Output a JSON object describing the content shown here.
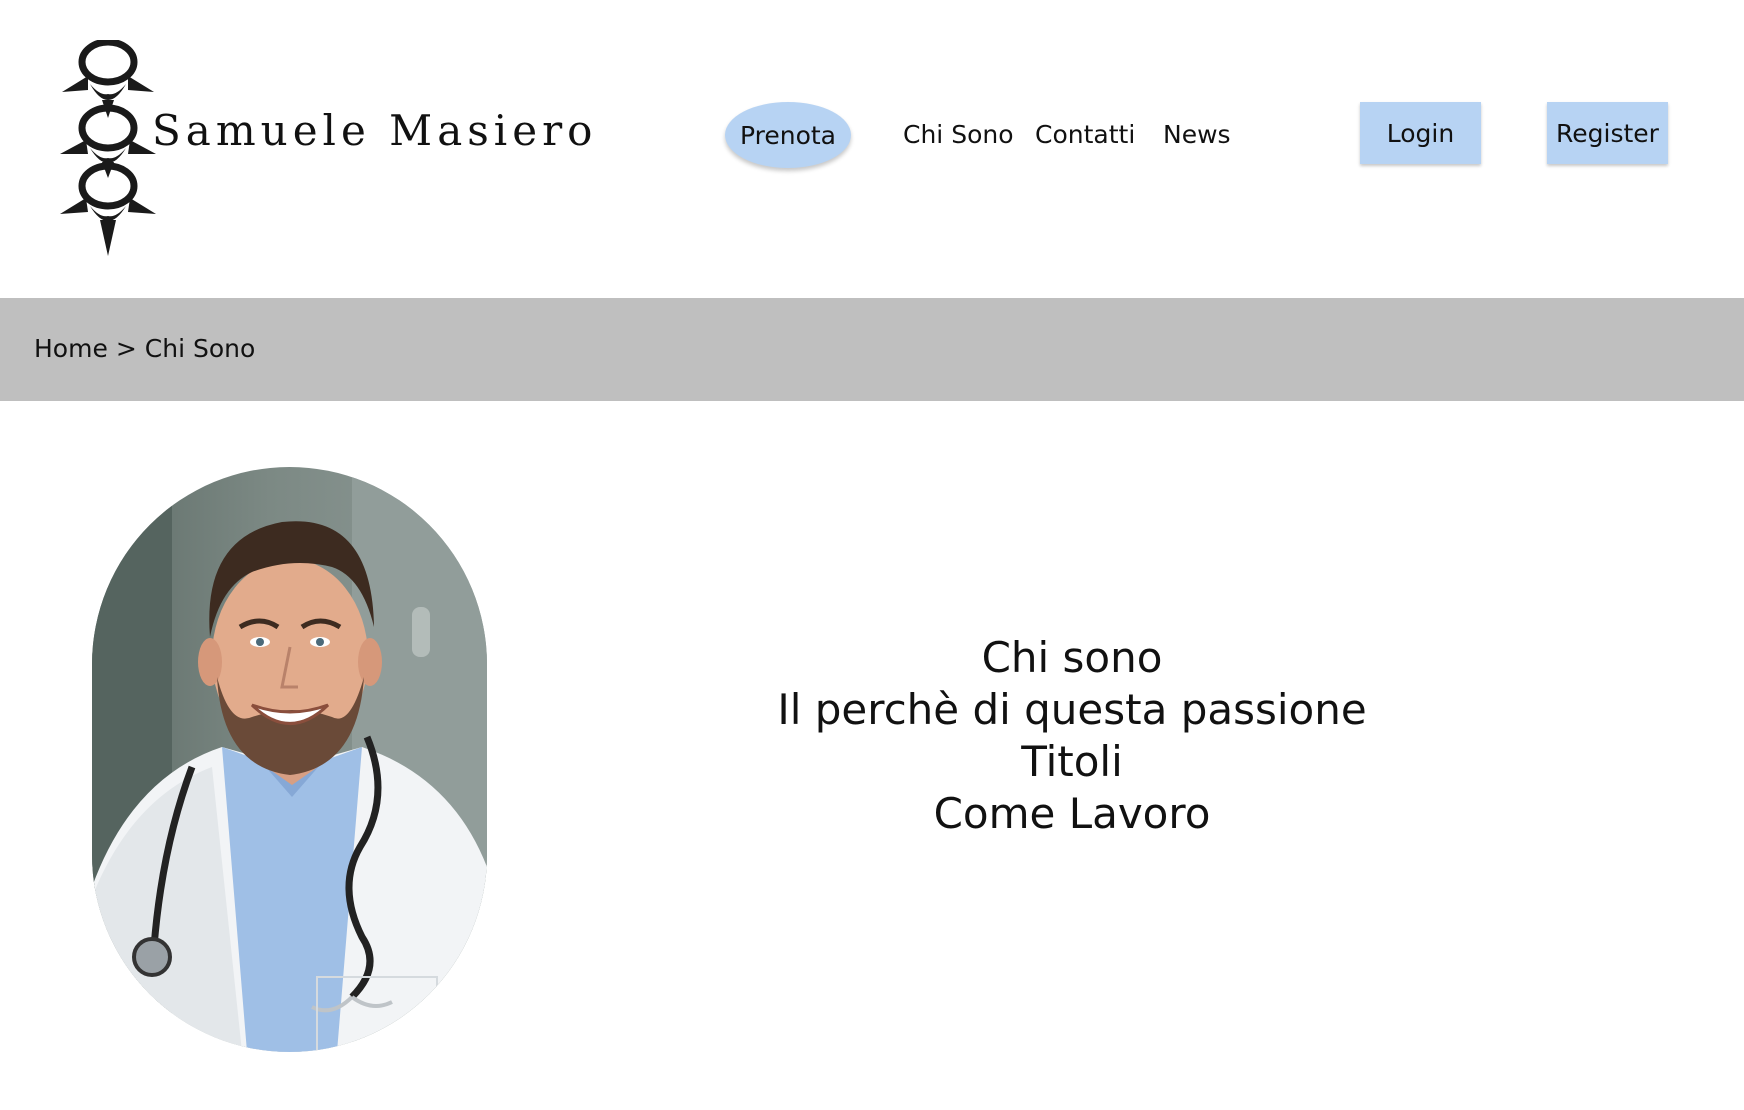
{
  "brand": {
    "name": "Samuele Masiero",
    "logo_icon": "spine-icon"
  },
  "nav": {
    "prenota_label": "Prenota",
    "items": [
      {
        "label": "Chi Sono"
      },
      {
        "label": "Contatti"
      },
      {
        "label": "News"
      }
    ],
    "login_label": "Login",
    "register_label": "Register"
  },
  "breadcrumb": {
    "home": "Home",
    "separator": ">",
    "current": "Chi Sono"
  },
  "main": {
    "photo_subject": "doctor-portrait",
    "links": [
      {
        "label": "Chi sono"
      },
      {
        "label": "Il perchè di questa passione"
      },
      {
        "label": "Titoli"
      },
      {
        "label": "Come Lavoro"
      }
    ]
  },
  "colors": {
    "button_bg": "#b7d3f3",
    "breadcrumb_bg": "#bfbfbf",
    "text": "#111111"
  }
}
